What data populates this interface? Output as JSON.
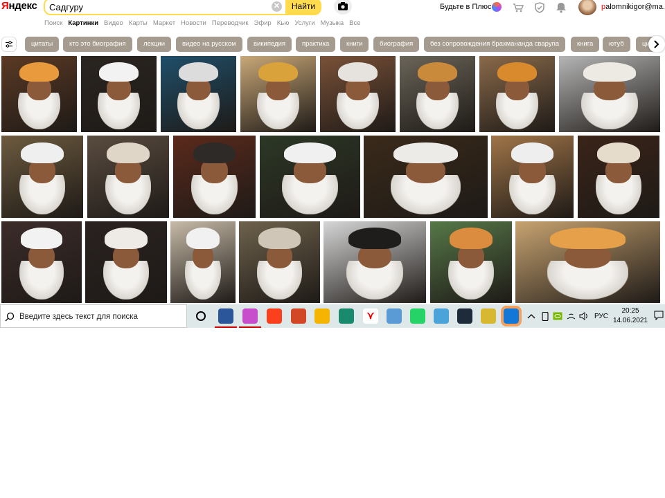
{
  "header": {
    "logo_prefix": "Я",
    "logo_rest": "ндекс",
    "search_value": "Садгуру",
    "clear_symbol": "✕",
    "find_label": "Найти",
    "plus_label": "Будьте в Плюсе",
    "user_first": "p",
    "user_rest": "alomnikigor@ma..."
  },
  "nav": {
    "items": [
      "Поиск",
      "Картинки",
      "Видео",
      "Карты",
      "Маркет",
      "Новости",
      "Переводчик",
      "Эфир",
      "Кью",
      "Услуги",
      "Музыка",
      "Все"
    ],
    "active_index": 1
  },
  "chips": [
    "цитаты",
    "кто это биография",
    "лекции",
    "видео на русском",
    "википедия",
    "практика",
    "книги",
    "биография",
    "без сопровождения брахмананда сварупа",
    "книга",
    "ютуб",
    "ци"
  ],
  "colors": {
    "accent_yellow": "#ffdb4d",
    "chip_bg": "#a59b8f",
    "logo_red": "#ff0000",
    "taskbar_bg": "#dfe8e8"
  },
  "taskbar": {
    "search_placeholder": "Введите здесь текст для поиска",
    "icons": [
      "task-view-icon",
      "word-icon",
      "affinity-icon",
      "yandex-icon",
      "powerpoint-icon",
      "file-explorer-icon",
      "edge-icon",
      "yandex-browser-icon",
      "folder-icon",
      "whatsapp-icon",
      "screen-icon",
      "world-of-warships-icon",
      "game-icon",
      "app-icon"
    ],
    "language": "РУС",
    "time": "20:25",
    "date": "14.06.2021"
  }
}
